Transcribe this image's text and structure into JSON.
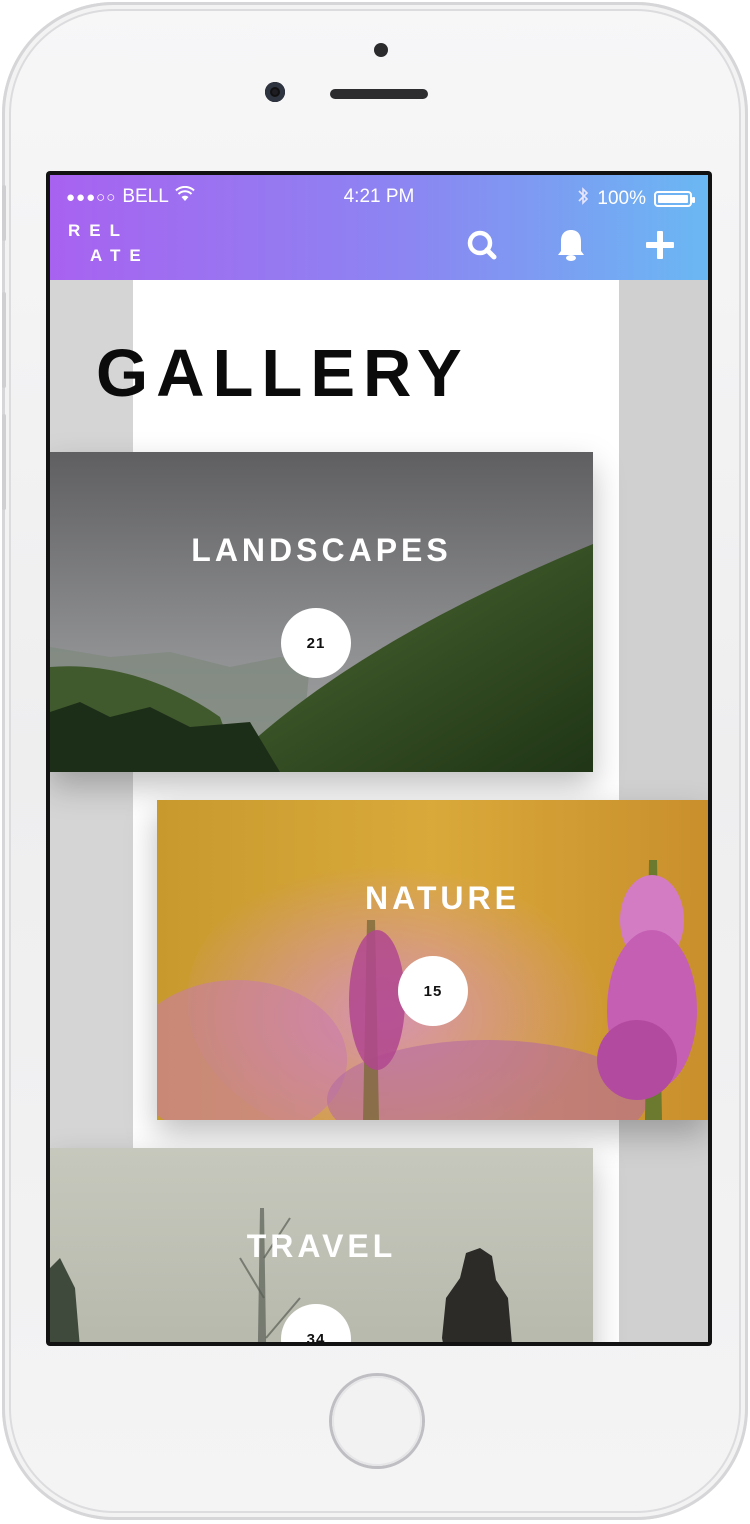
{
  "status": {
    "carrier": "BELL",
    "signal_dots": "●●●○○",
    "time": "4:21 PM",
    "battery": "100%"
  },
  "app": {
    "logo_line1": "REL",
    "logo_line2": "ATE"
  },
  "nav": {
    "search_icon": "search-icon",
    "bell_icon": "bell-icon",
    "add_icon": "plus-icon"
  },
  "page": {
    "title": "GALLERY"
  },
  "albums": [
    {
      "label": "LANDSCAPES",
      "count": "21"
    },
    {
      "label": "NATURE",
      "count": "15"
    },
    {
      "label": "TRAVEL",
      "count": "34"
    }
  ],
  "colors": {
    "header_gradient_start": "#a862f0",
    "header_gradient_end": "#6ab8f3"
  }
}
